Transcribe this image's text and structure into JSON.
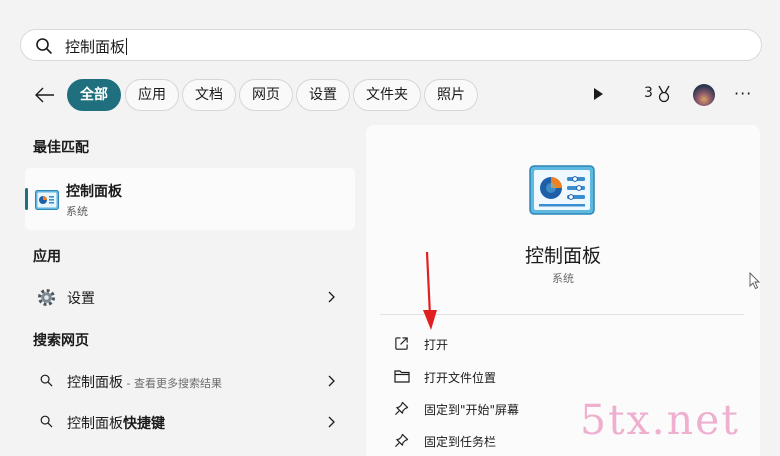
{
  "search": {
    "query": "控制面板"
  },
  "filters": [
    "全部",
    "应用",
    "文档",
    "网页",
    "设置",
    "文件夹",
    "照片"
  ],
  "toolbar": {
    "badge_count": "3",
    "more": "···"
  },
  "sections": {
    "best_match": "最佳匹配",
    "apps": "应用",
    "web": "搜索网页"
  },
  "best_match": {
    "name": "控制面板",
    "type": "系统"
  },
  "apps": [
    {
      "label": "设置"
    }
  ],
  "web_results": [
    {
      "term": "控制面板",
      "hint": " - 查看更多搜索结果"
    },
    {
      "term": "控制面板",
      "bold_suffix": "快捷键"
    }
  ],
  "detail": {
    "title": "控制面板",
    "subtitle": "系统",
    "actions": [
      "打开",
      "打开文件位置",
      "固定到\"开始\"屏幕",
      "固定到任务栏"
    ]
  },
  "watermark": "5tx.net",
  "colors": {
    "accent": "#1f6f7e",
    "annotation_arrow": "#e02020",
    "watermark": "#efb0d0"
  }
}
